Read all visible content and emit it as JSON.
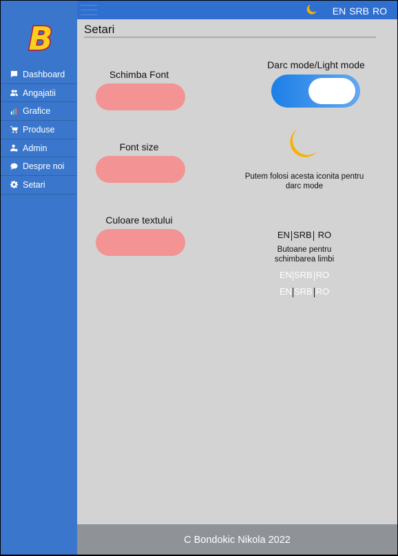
{
  "sidebar": {
    "logo_letter": "B",
    "items": [
      {
        "label": "Dashboard",
        "icon": "dashboard-icon"
      },
      {
        "label": "Angajatii",
        "icon": "users-icon"
      },
      {
        "label": "Grafice",
        "icon": "chart-icon"
      },
      {
        "label": "Produse",
        "icon": "cart-icon"
      },
      {
        "label": "Admin",
        "icon": "admin-icon"
      },
      {
        "label": "Despre noi",
        "icon": "chat-icon"
      },
      {
        "label": "Setari",
        "icon": "gear-icon"
      }
    ]
  },
  "topbar": {
    "lang_en": "EN",
    "lang_srb": "SRB",
    "lang_ro": "RO"
  },
  "page": {
    "title": "Setari",
    "font_label": "Schimba Font",
    "size_label": "Font size",
    "color_label": "Culoare textului",
    "mode_label": "Darc mode/Light mode",
    "moon_caption": "Putem folosi acesta iconita pentru darc mode",
    "lang_buttons_caption": "Butoane pentru schimbarea limbi",
    "lang_demo": {
      "en": "EN",
      "srb": "SRB",
      "ro": "RO"
    }
  },
  "footer": {
    "text": "C Bondokic Nikola 2022"
  },
  "colors": {
    "sidebar": "#3a77cc",
    "topbar": "#2f6fd0",
    "pill": "#f39393",
    "toggle": "#1b7fe6",
    "moon": "#f7b200",
    "footer": "#8f9398"
  }
}
